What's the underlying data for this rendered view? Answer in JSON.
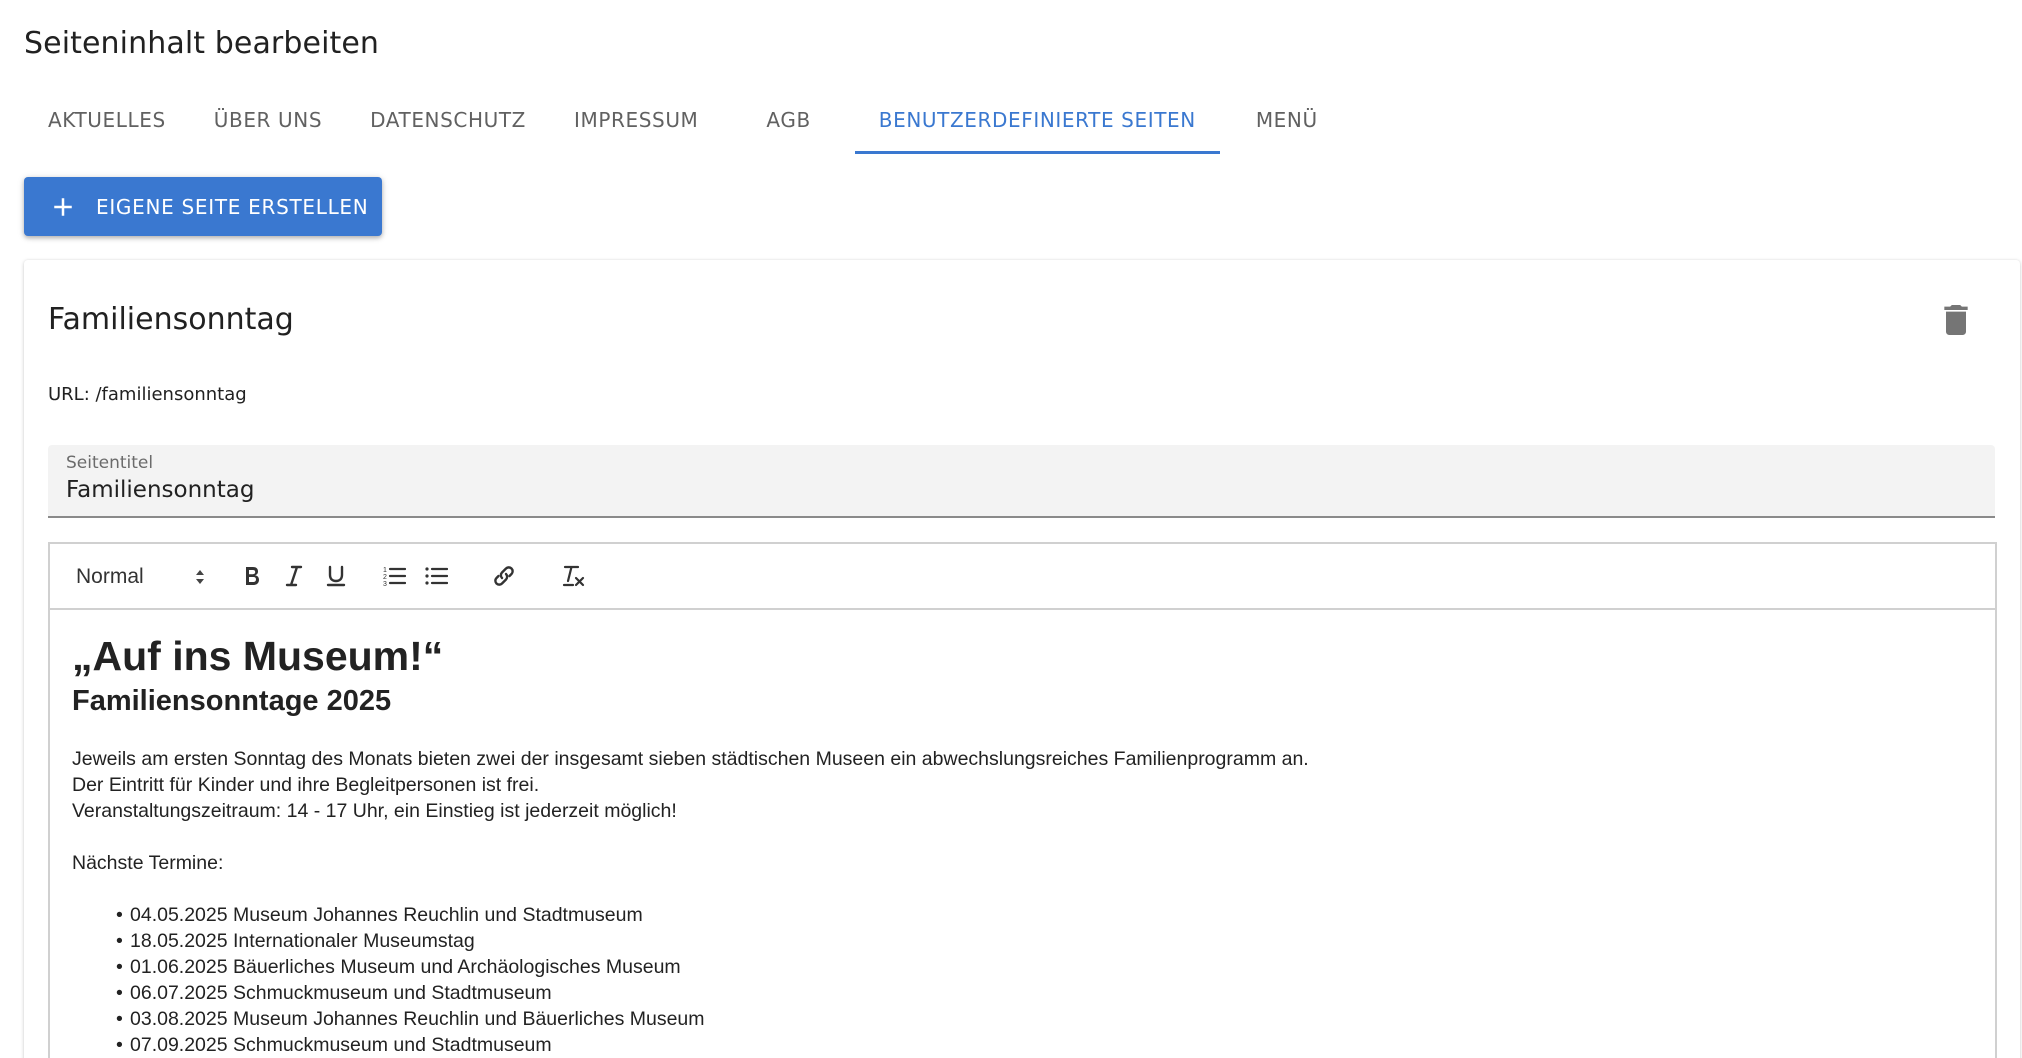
{
  "header": {
    "title": "Seiteninhalt bearbeiten"
  },
  "tabs": [
    {
      "label": "AKTUELLES",
      "active": false
    },
    {
      "label": "ÜBER UNS",
      "active": false
    },
    {
      "label": "DATENSCHUTZ",
      "active": false
    },
    {
      "label": "IMPRESSUM",
      "active": false
    },
    {
      "label": "AGB",
      "active": false
    },
    {
      "label": "BENUTZERDEFINIERTE SEITEN",
      "active": true
    },
    {
      "label": "MENÜ",
      "active": false
    }
  ],
  "create_button": {
    "label": "EIGENE SEITE ERSTELLEN",
    "icon": "plus-icon"
  },
  "page_card": {
    "title": "Familiensonntag",
    "url_line": "URL: /familiensonntag",
    "delete_icon": "trash-icon",
    "title_field": {
      "label": "Seitentitel",
      "value": "Familiensonntag"
    }
  },
  "editor": {
    "toolbar": {
      "format_value": "Normal",
      "buttons": [
        "bold-icon",
        "italic-icon",
        "underline-icon",
        "ordered-list-icon",
        "bullet-list-icon",
        "link-icon",
        "clear-format-icon"
      ]
    },
    "content": {
      "heading1": "„Auf ins Museum!“",
      "heading2": "Familiensonntage 2025",
      "paragraph_lines": [
        "Jeweils am ersten Sonntag des Monats bieten zwei der insgesamt sieben städtischen Museen ein abwechslungsreiches Familienprogramm an.",
        "Der Eintritt für Kinder und ihre Begleitpersonen ist frei.",
        "Veranstaltungszeitraum: 14 - 17 Uhr, ein Einstieg ist jederzeit möglich!"
      ],
      "next_dates_label": "Nächste Termine:",
      "dates": [
        "04.05.2025 Museum Johannes Reuchlin und Stadtmuseum",
        "18.05.2025 Internationaler Museumstag",
        "01.06.2025 Bäuerliches Museum und Archäologisches Museum",
        "06.07.2025 Schmuckmuseum und Stadtmuseum",
        "03.08.2025 Museum Johannes Reuchlin und Bäuerliches Museum",
        "07.09.2025 Schmuckmuseum und Stadtmuseum"
      ]
    }
  },
  "colors": {
    "accent": "#3a78d0",
    "tab_inactive": "#616161",
    "field_bg": "#f3f3f3"
  }
}
